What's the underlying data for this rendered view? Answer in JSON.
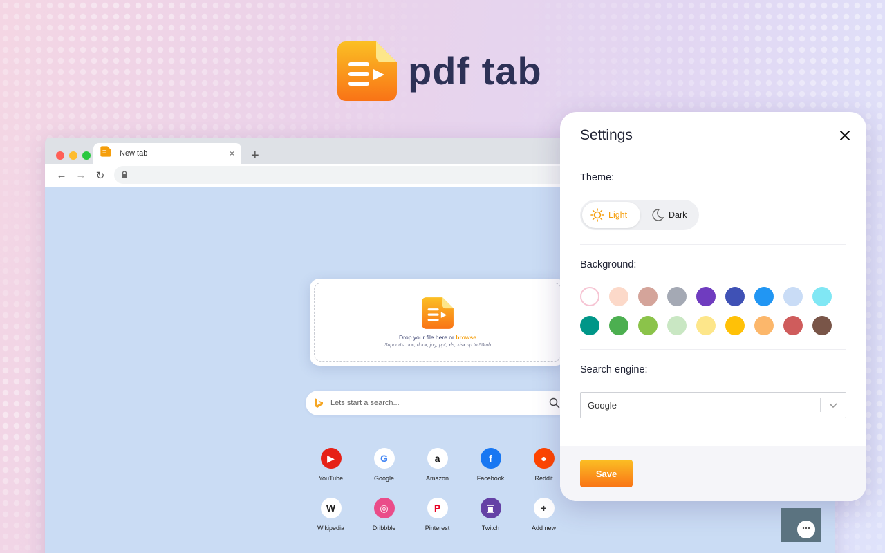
{
  "brand": {
    "name": "pdf tab"
  },
  "browser": {
    "tab_title": "New tab",
    "new_tab_glyph": "+",
    "close_glyph": "×",
    "nav": {
      "back": "←",
      "forward": "→",
      "reload": "↻"
    }
  },
  "dropzone": {
    "prompt": "Drop your file here or ",
    "browse": "browse",
    "supports": "Supports: doc, docx, jpg, ppt, xls, xlsx up to 50mb"
  },
  "search": {
    "placeholder": "Lets start a search..."
  },
  "shortcuts": [
    {
      "label": "YouTube",
      "icon": "youtube-icon",
      "color": "#e62117",
      "glyph": "▶",
      "fg": "#ffffff"
    },
    {
      "label": "Google",
      "icon": "google-icon",
      "color": "#ffffff",
      "glyph": "G",
      "fg": "#4285f4"
    },
    {
      "label": "Amazon",
      "icon": "amazon-icon",
      "color": "#ffffff",
      "glyph": "a",
      "fg": "#111111"
    },
    {
      "label": "Facebook",
      "icon": "facebook-icon",
      "color": "#1877f2",
      "glyph": "f",
      "fg": "#ffffff"
    },
    {
      "label": "Reddit",
      "icon": "reddit-icon",
      "color": "#ff4500",
      "glyph": "●",
      "fg": "#ffffff"
    },
    {
      "label": "Wikipedia",
      "icon": "wikipedia-icon",
      "color": "#ffffff",
      "glyph": "W",
      "fg": "#222222"
    },
    {
      "label": "Dribbble",
      "icon": "dribbble-icon",
      "color": "#ea4c89",
      "glyph": "◎",
      "fg": "#ffffff"
    },
    {
      "label": "Pinterest",
      "icon": "pinterest-icon",
      "color": "#ffffff",
      "glyph": "P",
      "fg": "#e60023"
    },
    {
      "label": "Twitch",
      "icon": "twitch-icon",
      "color": "#6441a5",
      "glyph": "▣",
      "fg": "#ffffff"
    },
    {
      "label": "Add new",
      "icon": "plus-icon",
      "color": "#ffffff",
      "glyph": "+",
      "fg": "#333333"
    }
  ],
  "settings": {
    "title": "Settings",
    "theme_label": "Theme:",
    "theme_options": {
      "light": "Light",
      "dark": "Dark"
    },
    "theme_selected": "Light",
    "background_label": "Background:",
    "background_colors": [
      "#ffffff",
      "#fcd9c9",
      "#d4a49a",
      "#a4a9b4",
      "#6f3cbf",
      "#3f51b5",
      "#2196f3",
      "#c9dcf6",
      "#80e7f4",
      "#009688",
      "#4caf50",
      "#8bc34a",
      "#c9e7c3",
      "#fde68a",
      "#ffc107",
      "#fcb76b",
      "#cf5c5c",
      "#795548"
    ],
    "background_selected": "#ffffff",
    "search_engine_label": "Search engine:",
    "search_engine_value": "Google",
    "save_label": "Save"
  },
  "chat": {
    "glyph": "⋯"
  },
  "colors": {
    "accent": "#f59e0b",
    "brand_text": "#2d3156"
  }
}
